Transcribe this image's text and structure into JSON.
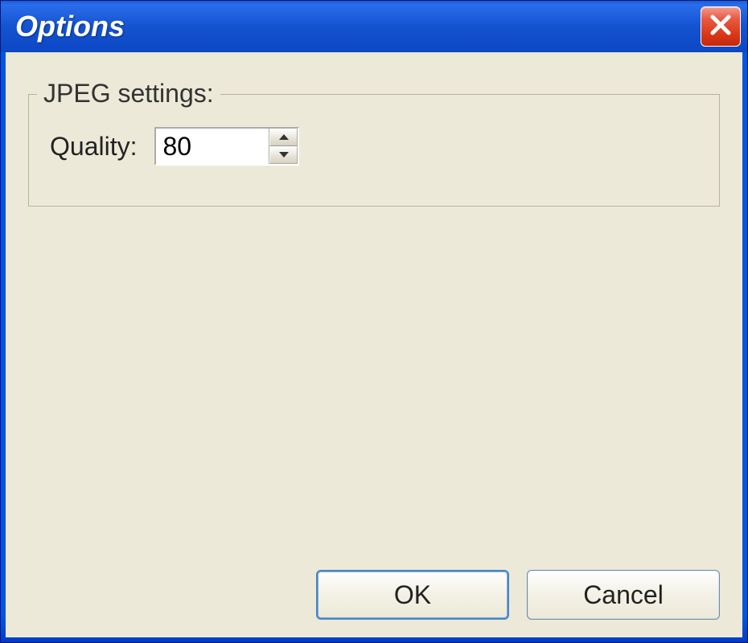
{
  "window": {
    "title": "Options"
  },
  "group": {
    "legend": "JPEG settings:"
  },
  "quality": {
    "label": "Quality:",
    "value": "80"
  },
  "buttons": {
    "ok": "OK",
    "cancel": "Cancel"
  }
}
